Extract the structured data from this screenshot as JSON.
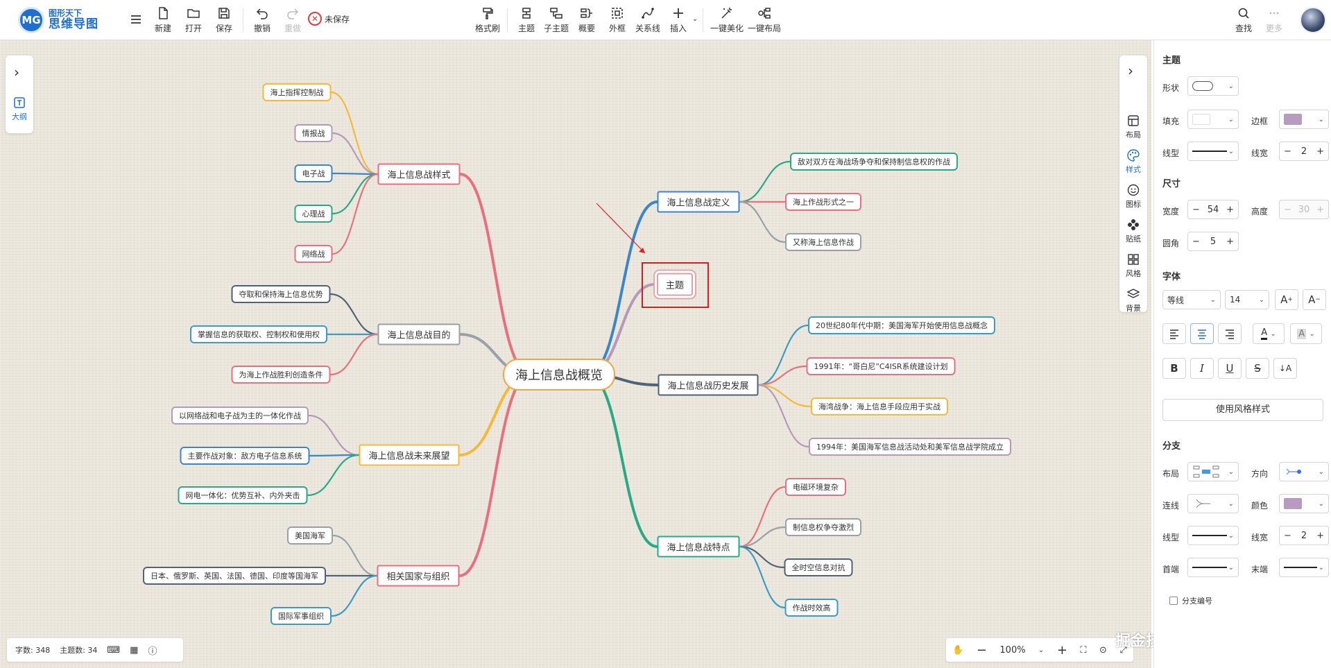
{
  "app": {
    "logo_line1": "图形天下",
    "logo_line2": "思维导图",
    "logo_badge": "MG",
    "brand_color": "#1f6fd1"
  },
  "toolbar": {
    "new": "新建",
    "open": "打开",
    "save": "保存",
    "undo": "撤销",
    "redo": "重做",
    "unsaved": "未保存",
    "format_brush": "格式刷",
    "topic": "主题",
    "subtopic": "子主题",
    "summary": "概要",
    "boundary": "外框",
    "relation": "关系线",
    "insert": "插入",
    "beautify": "一键美化",
    "auto_layout": "一键布局",
    "search": "查找",
    "more": "更多"
  },
  "left_sidebar": {
    "outline": "大纲"
  },
  "right_sidebar": [
    "布局",
    "样式",
    "图标",
    "贴纸",
    "风格",
    "背景"
  ],
  "mindmap": {
    "root": "海上信息战概览",
    "selected_topic": "主题",
    "branches": {
      "styles": {
        "title": "海上信息战样式",
        "color": "#e8707e",
        "children": [
          "海上指挥控制战",
          "情报战",
          "电子战",
          "心理战",
          "网络战"
        ],
        "child_colors": [
          "#f5b93a",
          "#b49ab8",
          "#3a86c8",
          "#2aa987",
          "#e8707e"
        ]
      },
      "purpose": {
        "title": "海上信息战目的",
        "color": "#9aa0a6",
        "children": [
          "夺取和保持海上信息优势",
          "掌握信息的获取权、控制权和使用权",
          "为海上作战胜利创造条件"
        ],
        "child_colors": [
          "#4f6378",
          "#3a9cc4",
          "#e8707e"
        ]
      },
      "future": {
        "title": "海上信息战未来展望",
        "color": "#f5b93a",
        "children": [
          "以网络战和电子战为主的一体化作战",
          "主要作战对象：敌方电子信息系统",
          "网电一体化：优势互补、内外夹击"
        ],
        "child_colors": [
          "#b49ab8",
          "#3a86c8",
          "#2aa987"
        ]
      },
      "countries": {
        "title": "相关国家与组织",
        "color": "#e8707e",
        "children": [
          "美国海军",
          "日本、俄罗斯、英国、法国、德国、印度等国海军",
          "国际军事组织"
        ],
        "child_colors": [
          "#9aa0a6",
          "#4f6378",
          "#3a9cc4"
        ]
      },
      "definition": {
        "title": "海上信息战定义",
        "color": "#3a86c8",
        "children": [
          "敌对双方在海战场争夺和保持制信息权的作战",
          "海上作战形式之一",
          "又称海上信息作战"
        ],
        "child_colors": [
          "#2aa987",
          "#e8707e",
          "#9aa0a6"
        ]
      },
      "history": {
        "title": "海上信息战历史发展",
        "color": "#4f6378",
        "children": [
          "20世纪80年代中期：美国海军开始使用信息战概念",
          "1991年：“哥白尼”C4ISR系统建设计划",
          "海湾战争：海上信息手段应用于实战",
          "1994年：美国海军信息战活动处和美军信息战学院成立"
        ],
        "child_colors": [
          "#3a9cc4",
          "#e8707e",
          "#f5b93a",
          "#b49ab8"
        ]
      },
      "features": {
        "title": "海上信息战特点",
        "color": "#2aa987",
        "children": [
          "电磁环境复杂",
          "制信息权争夺激烈",
          "全时空信息对抗",
          "作战时效高"
        ],
        "child_colors": [
          "#e8707e",
          "#9aa0a6",
          "#4f6378",
          "#3a9cc4"
        ]
      }
    }
  },
  "status_bar": {
    "word_count": "字数: 348",
    "topic_count": "主题数: 34"
  },
  "zoom": {
    "level": "100%"
  },
  "watermark": "掘金技术社区 @ 图形天下",
  "panel": {
    "topic_header": "主题",
    "shape": "形状",
    "fill": "填充",
    "border": "边框",
    "line_type": "线型",
    "line_width": "线宽",
    "line_width_value": "2",
    "size_header": "尺寸",
    "width": "宽度",
    "width_value": "54",
    "height": "高度",
    "height_value": "30",
    "radius": "圆角",
    "radius_value": "5",
    "font_header": "字体",
    "font_family": "等线",
    "font_size": "14",
    "apply_style": "使用风格样式",
    "branch_header": "分支",
    "layout": "布局",
    "direction": "方向",
    "connector": "连线",
    "color": "颜色",
    "branch_line_type": "线型",
    "branch_line_width": "线宽",
    "branch_line_width_value": "2",
    "head": "首端",
    "tail": "末端",
    "branch_numbering": "分支编号",
    "border_color": "#b89bc0",
    "branch_color": "#b89bc0"
  }
}
